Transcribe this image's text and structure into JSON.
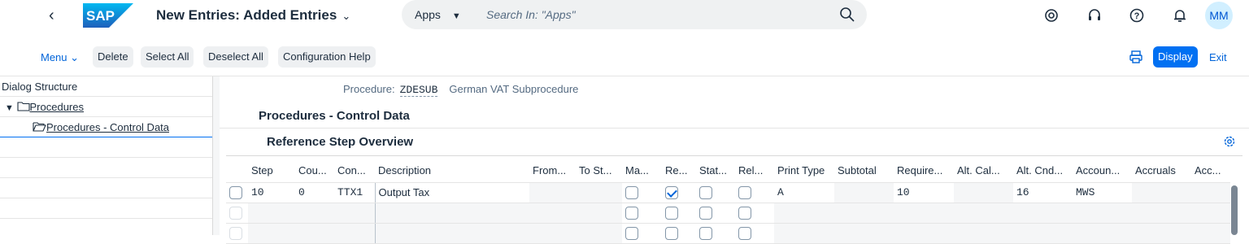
{
  "shell": {
    "logo_text": "SAP",
    "title": "New Entries: Added Entries",
    "search_scope": "Apps",
    "search_placeholder": "Search In: \"Apps\"",
    "avatar_initials": "MM"
  },
  "toolbar": {
    "menu_label": "Menu",
    "delete_label": "Delete",
    "select_all_label": "Select All",
    "deselect_all_label": "Deselect All",
    "config_help_label": "Configuration Help",
    "display_label": "Display",
    "exit_label": "Exit"
  },
  "sidebar": {
    "header": "Dialog Structure",
    "items": [
      {
        "label": "Procedures"
      },
      {
        "label": "Procedures - Control Data"
      }
    ]
  },
  "main": {
    "procedure_label": "Procedure:",
    "procedure_value": "ZDESUB",
    "procedure_desc": "German VAT Subprocedure",
    "section_title": "Procedures - Control Data",
    "table_title": "Reference Step Overview",
    "columns": [
      "Step",
      "Cou...",
      "Con...",
      "Description",
      "From...",
      "To St...",
      "Ma...",
      "Re...",
      "Stat...",
      "Rel...",
      "Print Type",
      "Subtotal",
      "Require...",
      "Alt. Cal...",
      "Alt. Cnd...",
      "Accoun...",
      "Accruals",
      "Acc..."
    ],
    "rows": [
      {
        "step": "10",
        "counter": "0",
        "condition": "TTX1",
        "description": "Output Tax",
        "from": "",
        "to": "",
        "manual": false,
        "required": true,
        "statistical": false,
        "relevant": false,
        "print_type": "A",
        "subtotal": "",
        "requirement": "10",
        "alt_calc": "",
        "alt_cnd": "16",
        "account": "MWS",
        "accruals": "",
        "acc2": ""
      }
    ]
  }
}
